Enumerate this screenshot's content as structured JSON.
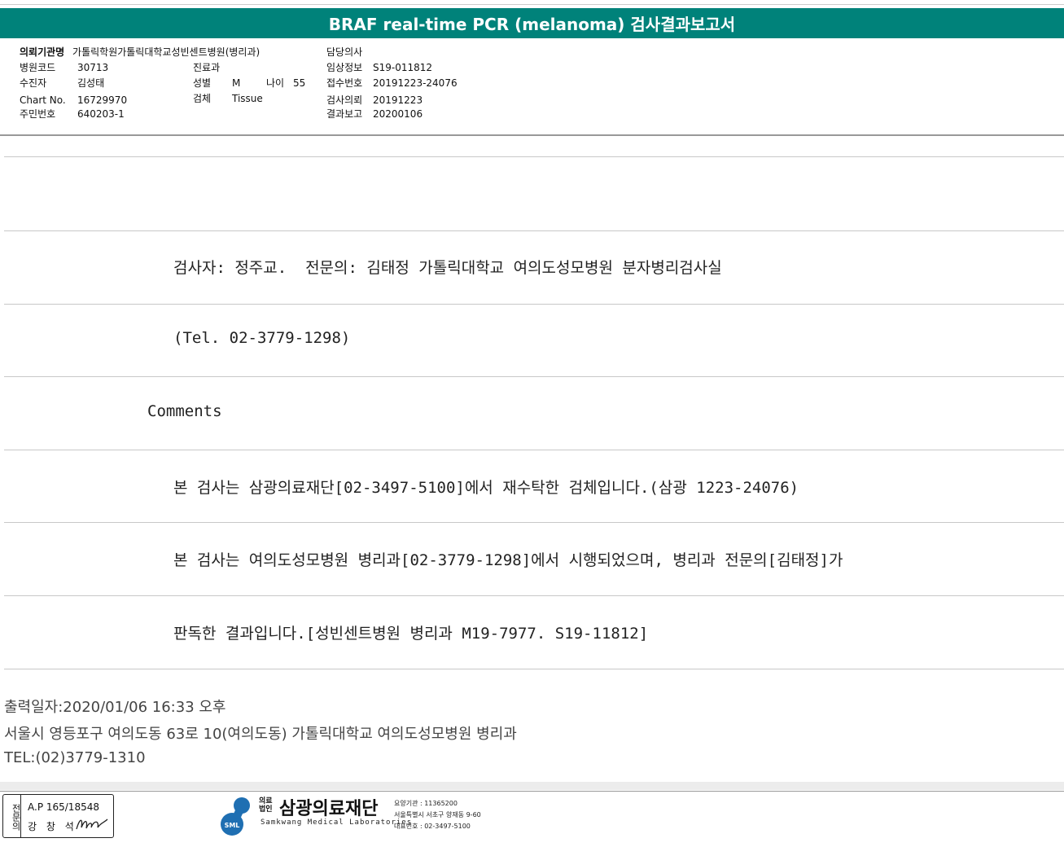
{
  "title": "BRAF real-time PCR (melanoma) 검사결과보고서",
  "header": {
    "institution_label": "의뢰기관명",
    "institution_value": "가톨릭학원가톨릭대학교성빈센트병원(병리과)",
    "hospital_code_label": "병원코드",
    "hospital_code_value": "30713",
    "patient_label": "수진자",
    "patient_value": "김성태",
    "chart_label": "Chart No.",
    "chart_value": "16729970",
    "resident_label": "주민번호",
    "resident_value": "640203-1",
    "department_label": "진료과",
    "department_value": "",
    "sex_label": "성별",
    "sex_value": "M",
    "age_label": "나이",
    "age_value": "55",
    "specimen_label": "검체",
    "specimen_value": "Tissue",
    "doctor_label": "담당의사",
    "doctor_value": "",
    "clinical_label": "임상정보",
    "clinical_value": "S19-011812",
    "receipt_label": "접수번호",
    "receipt_value": "20191223-24076",
    "request_label": "검사의뢰",
    "request_value": "20191223",
    "report_label": "결과보고",
    "report_value": "20200106"
  },
  "report_lines": [
    "검사자: 정주교.  전문의: 김태정 가톨릭대학교 여의도성모병원 분자병리검사실",
    "(Tel. 02-3779-1298)",
    "Comments",
    "본 검사는 삼광의료재단[02-3497-5100]에서 재수탁한 검체입니다.(삼광 1223-24076)",
    "본 검사는 여의도성모병원 병리과[02-3779-1298]에서 시행되었으며, 병리과 전문의[김태정]가",
    "판독한 결과입니다.[성빈센트병원 병리과 M19-7977. S19-11812]"
  ],
  "footer": {
    "print_date": "출력일자:2020/01/06 16:33 오후",
    "address": "서울시 영등포구 여의도동 63로 10(여의도동) 가톨릭대학교 여의도성모병원 병리과",
    "tel": "TEL:(02)3779-1310"
  },
  "signature": {
    "side_label": "전문의",
    "ap_number": "A.P 165/18548",
    "name": "강 창 석"
  },
  "logo": {
    "corp_label": "의료법인",
    "name_ko": "삼광의료재단",
    "name_en": "Samkwang Medical Laboratories",
    "icon_text": "SML",
    "info_code": "요양기관 : 11365200",
    "info_address": "서울특별시 서초구 양재동 9-60",
    "info_phone": "대표번호 : 02-3497-5100"
  },
  "colors": {
    "title_bar": "#00827a"
  }
}
